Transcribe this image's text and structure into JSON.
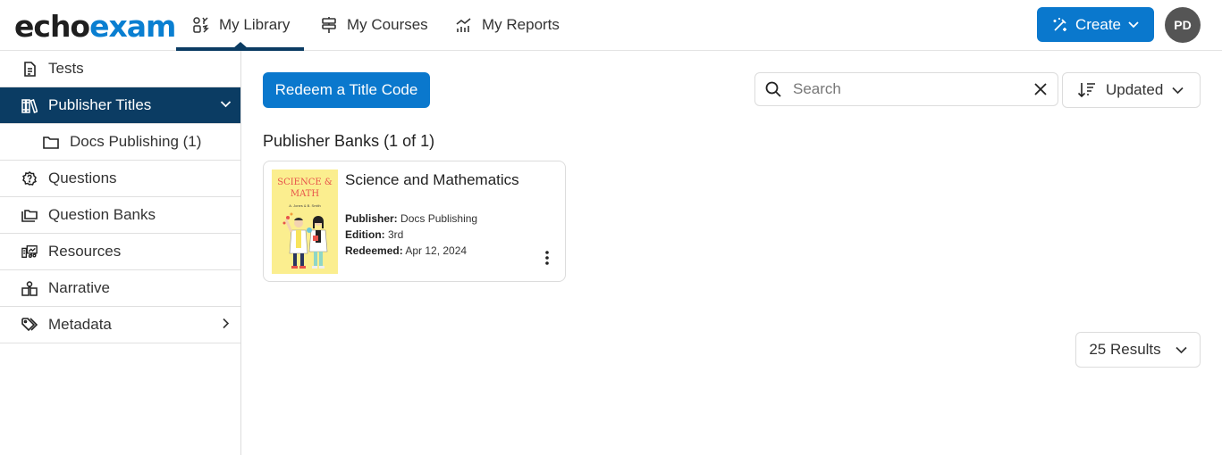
{
  "app": {
    "logo_part1": "echo",
    "logo_part2": "exam",
    "brand_color": "#0a78cd",
    "nav_active_color": "#0b3c63"
  },
  "topnav": {
    "tabs": [
      {
        "label": "My Library",
        "icon": "library-icon",
        "active": true
      },
      {
        "label": "My Courses",
        "icon": "signpost-icon",
        "active": false
      },
      {
        "label": "My Reports",
        "icon": "reports-chart-icon",
        "active": false
      }
    ],
    "create_label": "Create",
    "avatar_initials": "PD"
  },
  "sidebar": {
    "items": [
      {
        "label": "Tests",
        "icon": "test-document-icon"
      },
      {
        "label": "Publisher Titles",
        "icon": "books-icon",
        "active": true,
        "expanded": true
      },
      {
        "label": "Docs Publishing (1)",
        "icon": "folder-icon",
        "sub": true
      },
      {
        "label": "Questions",
        "icon": "question-icon"
      },
      {
        "label": "Question Banks",
        "icon": "folders-icon"
      },
      {
        "label": "Resources",
        "icon": "resources-media-icon"
      },
      {
        "label": "Narrative",
        "icon": "narrative-reader-icon"
      },
      {
        "label": "Metadata",
        "icon": "tags-icon",
        "has_submenu": true
      }
    ]
  },
  "main": {
    "redeem_label": "Redeem a Title Code",
    "search": {
      "placeholder": "Search",
      "value": ""
    },
    "sort_label": "Updated",
    "section_title": "Publisher Banks (1 of 1)",
    "cards": [
      {
        "title": "Science and Mathematics",
        "cover_title": "SCIENCE & MATH",
        "cover_authors": "A. Jones & B. Smith",
        "publisher_label": "Publisher:",
        "publisher": "Docs Publishing",
        "edition_label": "Edition:",
        "edition": "3rd",
        "redeemed_label": "Redeemed:",
        "redeemed": "Apr 12, 2024"
      }
    ],
    "results_label": "25 Results"
  }
}
